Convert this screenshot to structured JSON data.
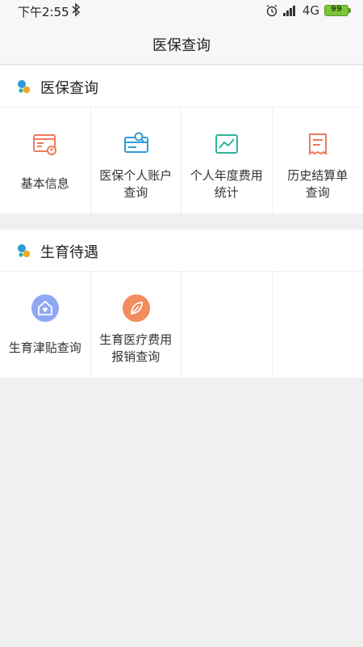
{
  "status_bar": {
    "time": "下午2:55",
    "network": "4G",
    "battery": "99",
    "icons": [
      "bluetooth-icon",
      "alarm-icon",
      "signal-icon"
    ]
  },
  "nav": {
    "title": "医保查询"
  },
  "sections": [
    {
      "title": "医保查询",
      "items": [
        {
          "label": "基本信息",
          "icon": "id-card-icon",
          "color": "#ee7a5c"
        },
        {
          "label": "医保个人账户\n查询",
          "icon": "card-search-icon",
          "color": "#2f9bd8"
        },
        {
          "label": "个人年度费用\n统计",
          "icon": "line-chart-icon",
          "color": "#2db59a"
        },
        {
          "label": "历史结算单\n查询",
          "icon": "receipt-icon",
          "color": "#ee7a5c"
        }
      ]
    },
    {
      "title": "生育待遇",
      "items": [
        {
          "label": "生育津贴查询",
          "icon": "home-heart-icon",
          "color": "#8fa8f5"
        },
        {
          "label": "生育医疗费用\n报销查询",
          "icon": "leaf-icon",
          "color": "#f28b5e"
        }
      ]
    }
  ],
  "colors": {
    "background": "#f0f0f0",
    "logo_blue": "#2f9bd8",
    "logo_orange": "#f5a623"
  }
}
